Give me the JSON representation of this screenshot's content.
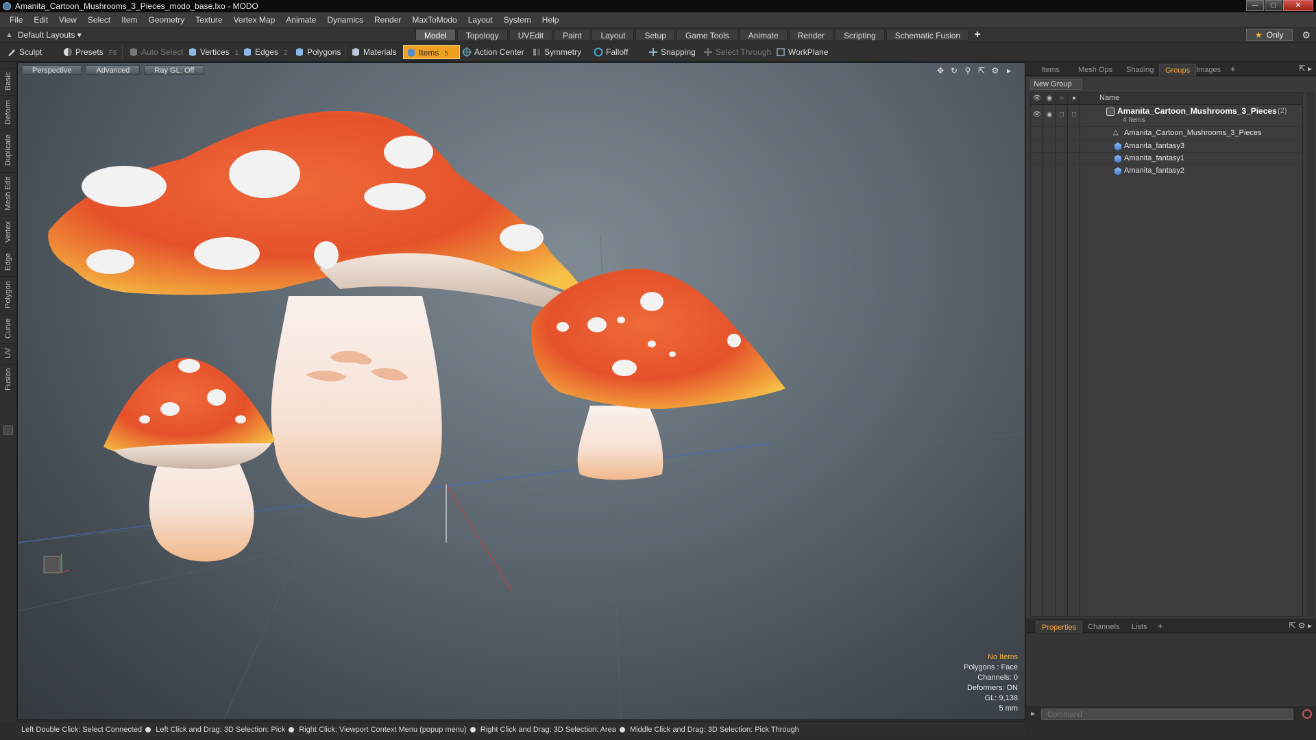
{
  "window": {
    "title": "Amanita_Cartoon_Mushrooms_3_Pieces_modo_base.lxo - MODO"
  },
  "menu": [
    "File",
    "Edit",
    "View",
    "Select",
    "Item",
    "Geometry",
    "Texture",
    "Vertex Map",
    "Animate",
    "Dynamics",
    "Render",
    "MaxToModo",
    "Layout",
    "System",
    "Help"
  ],
  "layoutbar": {
    "layouts_label": "Default Layouts ▾",
    "tabs": [
      "Model",
      "Topology",
      "UVEdit",
      "Paint",
      "Layout",
      "Setup",
      "Game Tools",
      "Animate",
      "Render",
      "Scripting",
      "Schematic Fusion"
    ],
    "active_tab": "Model",
    "add_tab": "+",
    "only_label": "Only"
  },
  "toolbar": {
    "sculpt": "Sculpt",
    "presets": "Presets",
    "presets_key": "F6",
    "auto_select": "Auto Select",
    "vertices": "Vertices",
    "vertices_key": "1",
    "edges": "Edges",
    "edges_key": "2",
    "polygons": "Polygons",
    "materials": "Materials",
    "items": "Items",
    "items_key": "5",
    "action_center": "Action Center",
    "symmetry": "Symmetry",
    "falloff": "Falloff",
    "snapping": "Snapping",
    "select_through": "Select Through",
    "workplane": "WorkPlane"
  },
  "leftstrip": [
    "Basic",
    "Deform",
    "Duplicate",
    "Mesh Edit",
    "Vertex",
    "Edge",
    "Polygon",
    "Curve",
    "UV",
    "Fusion"
  ],
  "viewport": {
    "view_mode": "Perspective",
    "shading": "Advanced",
    "raygl": "Ray GL: Off",
    "info": {
      "selection": "No Items",
      "polygons": "Polygons : Face",
      "channels": "Channels: 0",
      "deformers": "Deformers: ON",
      "gl": "GL: 9,138",
      "scale": "5 mm"
    },
    "colors": {
      "cap": "#ec5a2c",
      "cap_rim": "#f5a838",
      "spots": "#f0f0f0",
      "stem": "#f3d2bd"
    }
  },
  "statusbar": {
    "hints": [
      "Left Double Click: Select Connected",
      "Left Click and Drag: 3D Selection: Pick",
      "Right Click: Viewport Context Menu (popup menu)",
      "Right Click and Drag: 3D Selection: Area",
      "Middle Click and Drag: 3D Selection: Pick Through"
    ]
  },
  "rightpanel": {
    "tabs": [
      "Items",
      "Mesh Ops",
      "Shading",
      "Groups",
      "Images"
    ],
    "active_tab": "Groups",
    "new_group": "New Group",
    "column_name": "Name",
    "tree": {
      "group": {
        "name": "Amanita_Cartoon_Mushrooms_3_Pieces",
        "count": "(2)",
        "sub": "4 Items"
      },
      "children": [
        "Amanita_Cartoon_Mushrooms_3_Pieces",
        "Amanita_fantasy3",
        "Amanita_fantasy1",
        "Amanita_fantasy2"
      ]
    },
    "bottom_tabs": [
      "Properties",
      "Channels",
      "Lists"
    ],
    "bottom_active": "Properties",
    "command_placeholder": "Command"
  }
}
